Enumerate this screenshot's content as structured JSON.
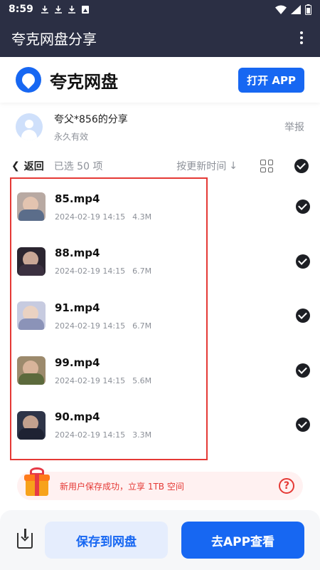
{
  "status_bar": {
    "time": "8:59",
    "icons": [
      "download-icon",
      "download-icon",
      "download-icon",
      "image-icon",
      "wifi-icon",
      "signal-icon",
      "battery-icon"
    ]
  },
  "header": {
    "title": "夸克网盘分享"
  },
  "brand": {
    "name": "夸克网盘",
    "open_app_label": "打开 APP",
    "color": "#1767f2"
  },
  "sharer": {
    "name": "夸父*856的分享",
    "validity": "永久有效",
    "report_label": "举报"
  },
  "toolbar": {
    "back_label": "返回",
    "selected_text": "已选 50 项",
    "sort_label": "按更新时间"
  },
  "files": [
    {
      "name": "85.mp4",
      "date": "2024-02-19 14:15",
      "size": "4.3M",
      "thumb": [
        "#b8a9a2",
        "#e3c4b0",
        "#5b6d8a"
      ]
    },
    {
      "name": "88.mp4",
      "date": "2024-02-19 14:15",
      "size": "6.7M",
      "thumb": [
        "#2b2530",
        "#c9a796",
        "#3b3040"
      ]
    },
    {
      "name": "91.mp4",
      "date": "2024-02-19 14:15",
      "size": "6.7M",
      "thumb": [
        "#c7cbe0",
        "#ead2c2",
        "#8b93b8"
      ]
    },
    {
      "name": "99.mp4",
      "date": "2024-02-19 14:15",
      "size": "5.6M",
      "thumb": [
        "#9c8a6c",
        "#d8b49a",
        "#5c6a3c"
      ]
    },
    {
      "name": "90.mp4",
      "date": "2024-02-19 14:15",
      "size": "3.3M",
      "thumb": [
        "#2e3448",
        "#c3a18e",
        "#1e2233"
      ]
    }
  ],
  "promo": {
    "text": "新用户保存成功，立享 1TB 空间",
    "color": "#e53935"
  },
  "bottom": {
    "save_label": "保存到网盘",
    "app_label": "去APP查看"
  }
}
